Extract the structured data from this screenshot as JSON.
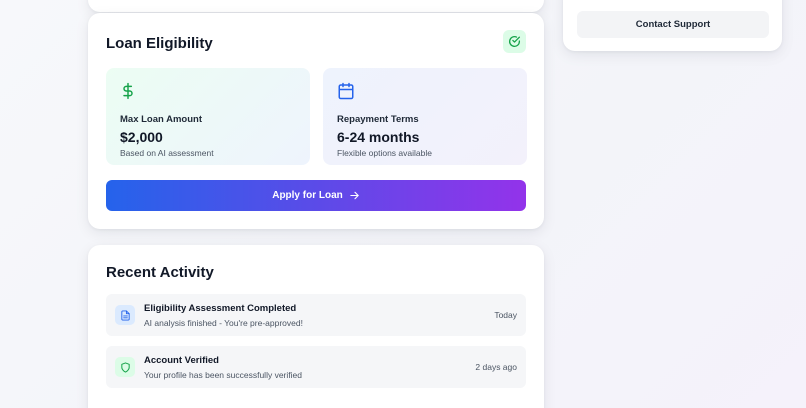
{
  "loan_eligibility": {
    "title": "Loan Eligibility",
    "status_icon": "check-circle-icon",
    "max_loan": {
      "icon": "dollar-icon",
      "label": "Max Loan Amount",
      "value": "$2,000",
      "note": "Based on AI assessment"
    },
    "repayment": {
      "icon": "calendar-icon",
      "label": "Repayment Terms",
      "value": "6-24 months",
      "note": "Flexible options available"
    },
    "apply_label": "Apply for Loan",
    "apply_icon": "arrow-right-icon"
  },
  "recent_activity": {
    "title": "Recent Activity",
    "items": [
      {
        "icon": "document-icon",
        "title": "Eligibility Assessment Completed",
        "description": "AI analysis finished - You're pre-approved!",
        "time": "Today"
      },
      {
        "icon": "shield-icon",
        "title": "Account Verified",
        "description": "Your profile has been successfully verified",
        "time": "2 days ago"
      }
    ]
  },
  "support": {
    "contact_label": "Contact Support"
  },
  "colors": {
    "accent_blue": "#2563eb",
    "accent_purple": "#9333ea",
    "success_green": "#16a34a"
  }
}
